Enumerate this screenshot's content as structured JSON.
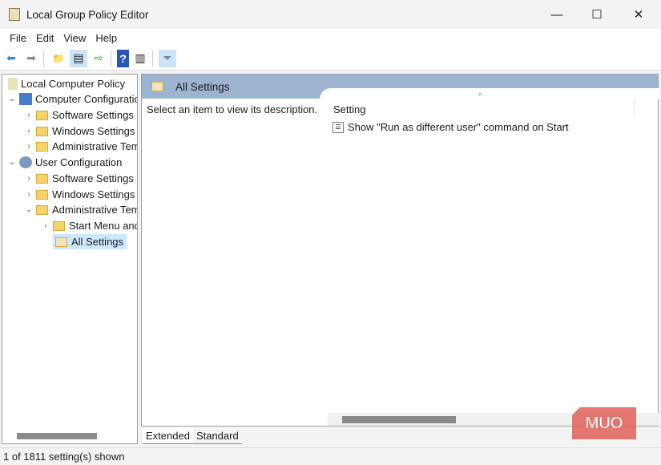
{
  "window": {
    "title": "Local Group Policy Editor",
    "minimize": "—",
    "maximize": "☐",
    "close": "✕"
  },
  "menu": [
    "File",
    "Edit",
    "View",
    "Help"
  ],
  "toolbar": {
    "back": "⬅",
    "forward": "➡",
    "up": "📁",
    "show_hide": "▤",
    "export": "⇨",
    "help": "?",
    "properties": "▥",
    "filter": "⏷"
  },
  "tree": [
    {
      "label": "Local Computer Policy"
    },
    {
      "label": "Computer Configuration"
    },
    {
      "label": "Software Settings"
    },
    {
      "label": "Windows Settings"
    },
    {
      "label": "Administrative Templates"
    },
    {
      "label": "User Configuration"
    },
    {
      "label": "Software Settings"
    },
    {
      "label": "Windows Settings"
    },
    {
      "label": "Administrative Templates"
    },
    {
      "label": "Start Menu and Taskbar"
    },
    {
      "label": "All Settings"
    }
  ],
  "main": {
    "header": "All Settings",
    "description": "Select an item to view its description.",
    "column": "Setting",
    "sort_glyph": "^",
    "rows": [
      "Show \"Run as different user\" command on Start"
    ]
  },
  "tabs": [
    "Extended",
    "Standard"
  ],
  "status": "1 of 1811 setting(s) shown",
  "watermark": "MUO"
}
